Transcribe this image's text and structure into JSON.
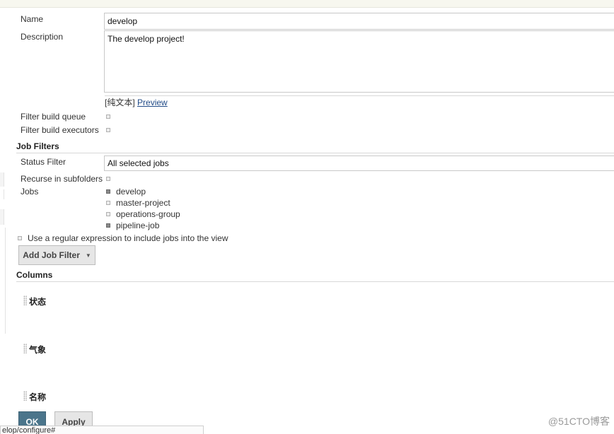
{
  "form": {
    "name_label": "Name",
    "name_value": "develop",
    "description_label": "Description",
    "description_value": "The develop project!",
    "text_format": "[纯文本]",
    "preview_link": "Preview",
    "filter_build_queue_label": "Filter build queue",
    "filter_build_queue_checked": false,
    "filter_build_executors_label": "Filter build executors",
    "filter_build_executors_checked": false
  },
  "job_filters": {
    "section_title": "Job Filters",
    "status_filter_label": "Status Filter",
    "status_filter_value": "All selected jobs",
    "recurse_label": "Recurse in subfolders",
    "recurse_checked": false,
    "jobs_label": "Jobs",
    "jobs": [
      {
        "name": "develop",
        "checked": true
      },
      {
        "name": "master-project",
        "checked": false
      },
      {
        "name": "operations-group",
        "checked": false
      },
      {
        "name": "pipeline-job",
        "checked": true
      }
    ],
    "regex_label": "Use a regular expression to include jobs into the view",
    "regex_checked": false,
    "add_filter_button": "Add Job Filter",
    "dropdown_icon": "caret-down-icon"
  },
  "columns": {
    "section_title": "Columns",
    "items": [
      "状态",
      "气象",
      "名称"
    ]
  },
  "buttons": {
    "ok": "OK",
    "apply": "Apply"
  },
  "status_bar": "elop/configure#",
  "watermark": "@51CTO博客",
  "colors": {
    "ok_button": "#4b758b",
    "link": "#204a87",
    "top_bar": "#f7f7ef"
  }
}
